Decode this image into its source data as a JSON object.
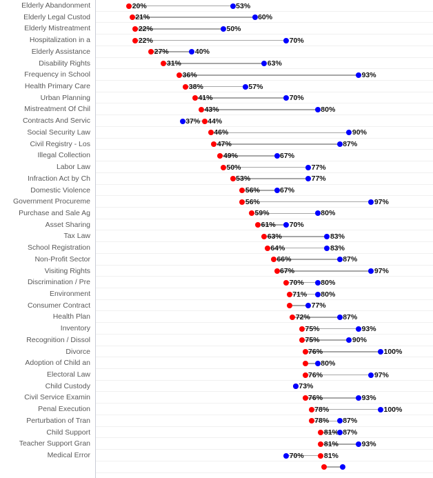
{
  "chart_data": {
    "type": "scatter",
    "chart_subtype": "dumbbell",
    "title": "",
    "subtitle": "",
    "xlabel": "",
    "ylabel": "",
    "xlim": [
      0,
      100
    ],
    "grid": true,
    "legend_position": "none",
    "value_suffix": "%",
    "series": [
      {
        "name": "low",
        "color": "#ff0000",
        "marker": "circle"
      },
      {
        "name": "high",
        "color": "#0000ff",
        "marker": "circle"
      }
    ],
    "categories": [
      "Elderly Abandonment",
      "Elderly Legal Custod",
      "Elderly Mistreatment",
      "Hospitalization in a",
      "Elderly Assistance",
      "Disability Rights",
      "Frequency in School",
      "Health Primary Care",
      "Urban Planning",
      "Mistreatment Of Chil",
      "Contracts And Servic",
      "Social Security Law",
      "Civil Registry - Los",
      "Illegal Collection",
      "Labor Law",
      "Infraction Act by Ch",
      "Domestic Violence",
      "Government Procureme",
      "Purchase and Sale Ag",
      "Asset Sharing",
      "Tax Law",
      "School Registration",
      "Non-Profit Sector",
      "Visiting Rights",
      "Discrimination / Pre",
      "Environment",
      "Consumer Contract",
      "Health Plan",
      "Inventory",
      "Recognition / Dissol",
      "Divorce",
      "Adoption of Child an",
      "Electoral Law",
      "Child Custody",
      "Civil Service Examin",
      "Penal Execution",
      "Perturbation of Tran",
      "Child Support",
      "Teacher Support Gran",
      "Medical Error",
      ""
    ],
    "rows": [
      {
        "category": "Elderly Abandonment",
        "low": 20,
        "high": 53,
        "low_label": "20%",
        "high_label": "53%",
        "show_low_label": true,
        "show_high_label": true
      },
      {
        "category": "Elderly Legal Custod",
        "low": 21,
        "high": 60,
        "low_label": "21%",
        "high_label": "60%",
        "show_low_label": true,
        "show_high_label": true
      },
      {
        "category": "Elderly Mistreatment",
        "low": 22,
        "high": 50,
        "low_label": "22%",
        "high_label": "50%",
        "show_low_label": true,
        "show_high_label": true
      },
      {
        "category": "Hospitalization in a",
        "low": 22,
        "high": 70,
        "low_label": "22%",
        "high_label": "70%",
        "show_low_label": true,
        "show_high_label": true
      },
      {
        "category": "Elderly Assistance",
        "low": 27,
        "high": 40,
        "low_label": "27%",
        "high_label": "40%",
        "show_low_label": true,
        "show_high_label": true
      },
      {
        "category": "Disability Rights",
        "low": 31,
        "high": 63,
        "low_label": "31%",
        "high_label": "63%",
        "show_low_label": true,
        "show_high_label": true
      },
      {
        "category": "Frequency in School",
        "low": 36,
        "high": 93,
        "low_label": "36%",
        "high_label": "93%",
        "show_low_label": true,
        "show_high_label": true
      },
      {
        "category": "Health Primary Care",
        "low": 38,
        "high": 57,
        "low_label": "38%",
        "high_label": "57%",
        "show_low_label": true,
        "show_high_label": true
      },
      {
        "category": "Urban Planning",
        "low": 41,
        "high": 70,
        "low_label": "41%",
        "high_label": "70%",
        "show_low_label": true,
        "show_high_label": true
      },
      {
        "category": "Mistreatment Of Chil",
        "low": 43,
        "high": 80,
        "low_label": "43%",
        "high_label": "80%",
        "show_low_label": true,
        "show_high_label": true
      },
      {
        "category": "Contracts And Servic",
        "low": 44,
        "high": 37,
        "low_label": "44%",
        "high_label": "37%",
        "show_low_label": true,
        "show_high_label": true
      },
      {
        "category": "Social Security Law",
        "low": 46,
        "high": 90,
        "low_label": "46%",
        "high_label": "90%",
        "show_low_label": true,
        "show_high_label": true
      },
      {
        "category": "Civil Registry - Los",
        "low": 47,
        "high": 87,
        "low_label": "47%",
        "high_label": "87%",
        "show_low_label": true,
        "show_high_label": true
      },
      {
        "category": "Illegal Collection",
        "low": 49,
        "high": 67,
        "low_label": "49%",
        "high_label": "67%",
        "show_low_label": true,
        "show_high_label": true
      },
      {
        "category": "Labor Law",
        "low": 50,
        "high": 77,
        "low_label": "50%",
        "high_label": "77%",
        "show_low_label": true,
        "show_high_label": true
      },
      {
        "category": "Infraction Act by Ch",
        "low": 53,
        "high": 77,
        "low_label": "53%",
        "high_label": "77%",
        "show_low_label": true,
        "show_high_label": true
      },
      {
        "category": "Domestic Violence",
        "low": 56,
        "high": 67,
        "low_label": "56%",
        "high_label": "67%",
        "show_low_label": true,
        "show_high_label": true
      },
      {
        "category": "Government Procureme",
        "low": 56,
        "high": 97,
        "low_label": "56%",
        "high_label": "97%",
        "show_low_label": true,
        "show_high_label": true
      },
      {
        "category": "Purchase and Sale Ag",
        "low": 59,
        "high": 80,
        "low_label": "59%",
        "high_label": "80%",
        "show_low_label": true,
        "show_high_label": true
      },
      {
        "category": "Asset Sharing",
        "low": 61,
        "high": 70,
        "low_label": "61%",
        "high_label": "70%",
        "show_low_label": true,
        "show_high_label": true
      },
      {
        "category": "Tax Law",
        "low": 63,
        "high": 83,
        "low_label": "63%",
        "high_label": "83%",
        "show_low_label": true,
        "show_high_label": true
      },
      {
        "category": "School Registration",
        "low": 64,
        "high": 83,
        "low_label": "64%",
        "high_label": "83%",
        "show_low_label": true,
        "show_high_label": true
      },
      {
        "category": "Non-Profit Sector",
        "low": 66,
        "high": 87,
        "low_label": "66%",
        "high_label": "87%",
        "show_low_label": true,
        "show_high_label": true
      },
      {
        "category": "Visiting Rights",
        "low": 67,
        "high": 97,
        "low_label": "67%",
        "high_label": "97%",
        "show_low_label": true,
        "show_high_label": true
      },
      {
        "category": "Discrimination / Pre",
        "low": 70,
        "high": 80,
        "low_label": "70%",
        "high_label": "80%",
        "show_low_label": true,
        "show_high_label": true
      },
      {
        "category": "Environment",
        "low": 71,
        "high": 80,
        "low_label": "71%",
        "high_label": "80%",
        "show_low_label": true,
        "show_high_label": true
      },
      {
        "category": "Consumer Contract",
        "low": 71,
        "high": 77,
        "low_label": "",
        "high_label": "77%",
        "show_low_label": false,
        "show_high_label": true
      },
      {
        "category": "Health Plan",
        "low": 72,
        "high": 87,
        "low_label": "72%",
        "high_label": "87%",
        "show_low_label": true,
        "show_high_label": true
      },
      {
        "category": "Inventory",
        "low": 75,
        "high": 93,
        "low_label": "75%",
        "high_label": "93%",
        "show_low_label": true,
        "show_high_label": true
      },
      {
        "category": "Recognition / Dissol",
        "low": 75,
        "high": 90,
        "low_label": "75%",
        "high_label": "90%",
        "show_low_label": true,
        "show_high_label": true
      },
      {
        "category": "Divorce",
        "low": 76,
        "high": 100,
        "low_label": "76%",
        "high_label": "100%",
        "show_low_label": true,
        "show_high_label": true
      },
      {
        "category": "Adoption of Child an",
        "low": 76,
        "high": 80,
        "low_label": "",
        "high_label": "80%",
        "show_low_label": false,
        "show_high_label": true
      },
      {
        "category": "Electoral Law",
        "low": 76,
        "high": 97,
        "low_label": "76%",
        "high_label": "97%",
        "show_low_label": true,
        "show_high_label": true
      },
      {
        "category": "Child Custody",
        "low": 73,
        "high": 73,
        "low_label": "",
        "high_label": "73%",
        "show_low_label": false,
        "show_high_label": true
      },
      {
        "category": "Civil Service Examin",
        "low": 76,
        "high": 93,
        "low_label": "76%",
        "high_label": "93%",
        "show_low_label": true,
        "show_high_label": true
      },
      {
        "category": "Penal Execution",
        "low": 78,
        "high": 100,
        "low_label": "78%",
        "high_label": "100%",
        "show_low_label": true,
        "show_high_label": true
      },
      {
        "category": "Perturbation of Tran",
        "low": 78,
        "high": 87,
        "low_label": "78%",
        "high_label": "87%",
        "show_low_label": true,
        "show_high_label": true
      },
      {
        "category": "Child Support",
        "low": 81,
        "high": 87,
        "low_label": "81%",
        "high_label": "87%",
        "show_low_label": true,
        "show_high_label": true
      },
      {
        "category": "Teacher Support Gran",
        "low": 81,
        "high": 93,
        "low_label": "81%",
        "high_label": "93%",
        "show_low_label": true,
        "show_high_label": true
      },
      {
        "category": "Medical Error",
        "low": 81,
        "high": 70,
        "low_label": "81%",
        "high_label": "70%",
        "show_low_label": true,
        "show_high_label": true
      },
      {
        "category": "",
        "low": 82,
        "high": 88,
        "low_label": "",
        "high_label": "",
        "show_low_label": false,
        "show_high_label": false
      }
    ]
  },
  "colors": {
    "low": "#ff0000",
    "high": "#0000ff",
    "connector": "#a6a6a6",
    "gridline": "#f0f0f0",
    "axis": "#c9ccd6",
    "label_text": "#595959",
    "value_text": "#111111",
    "background": "#ffffff"
  }
}
